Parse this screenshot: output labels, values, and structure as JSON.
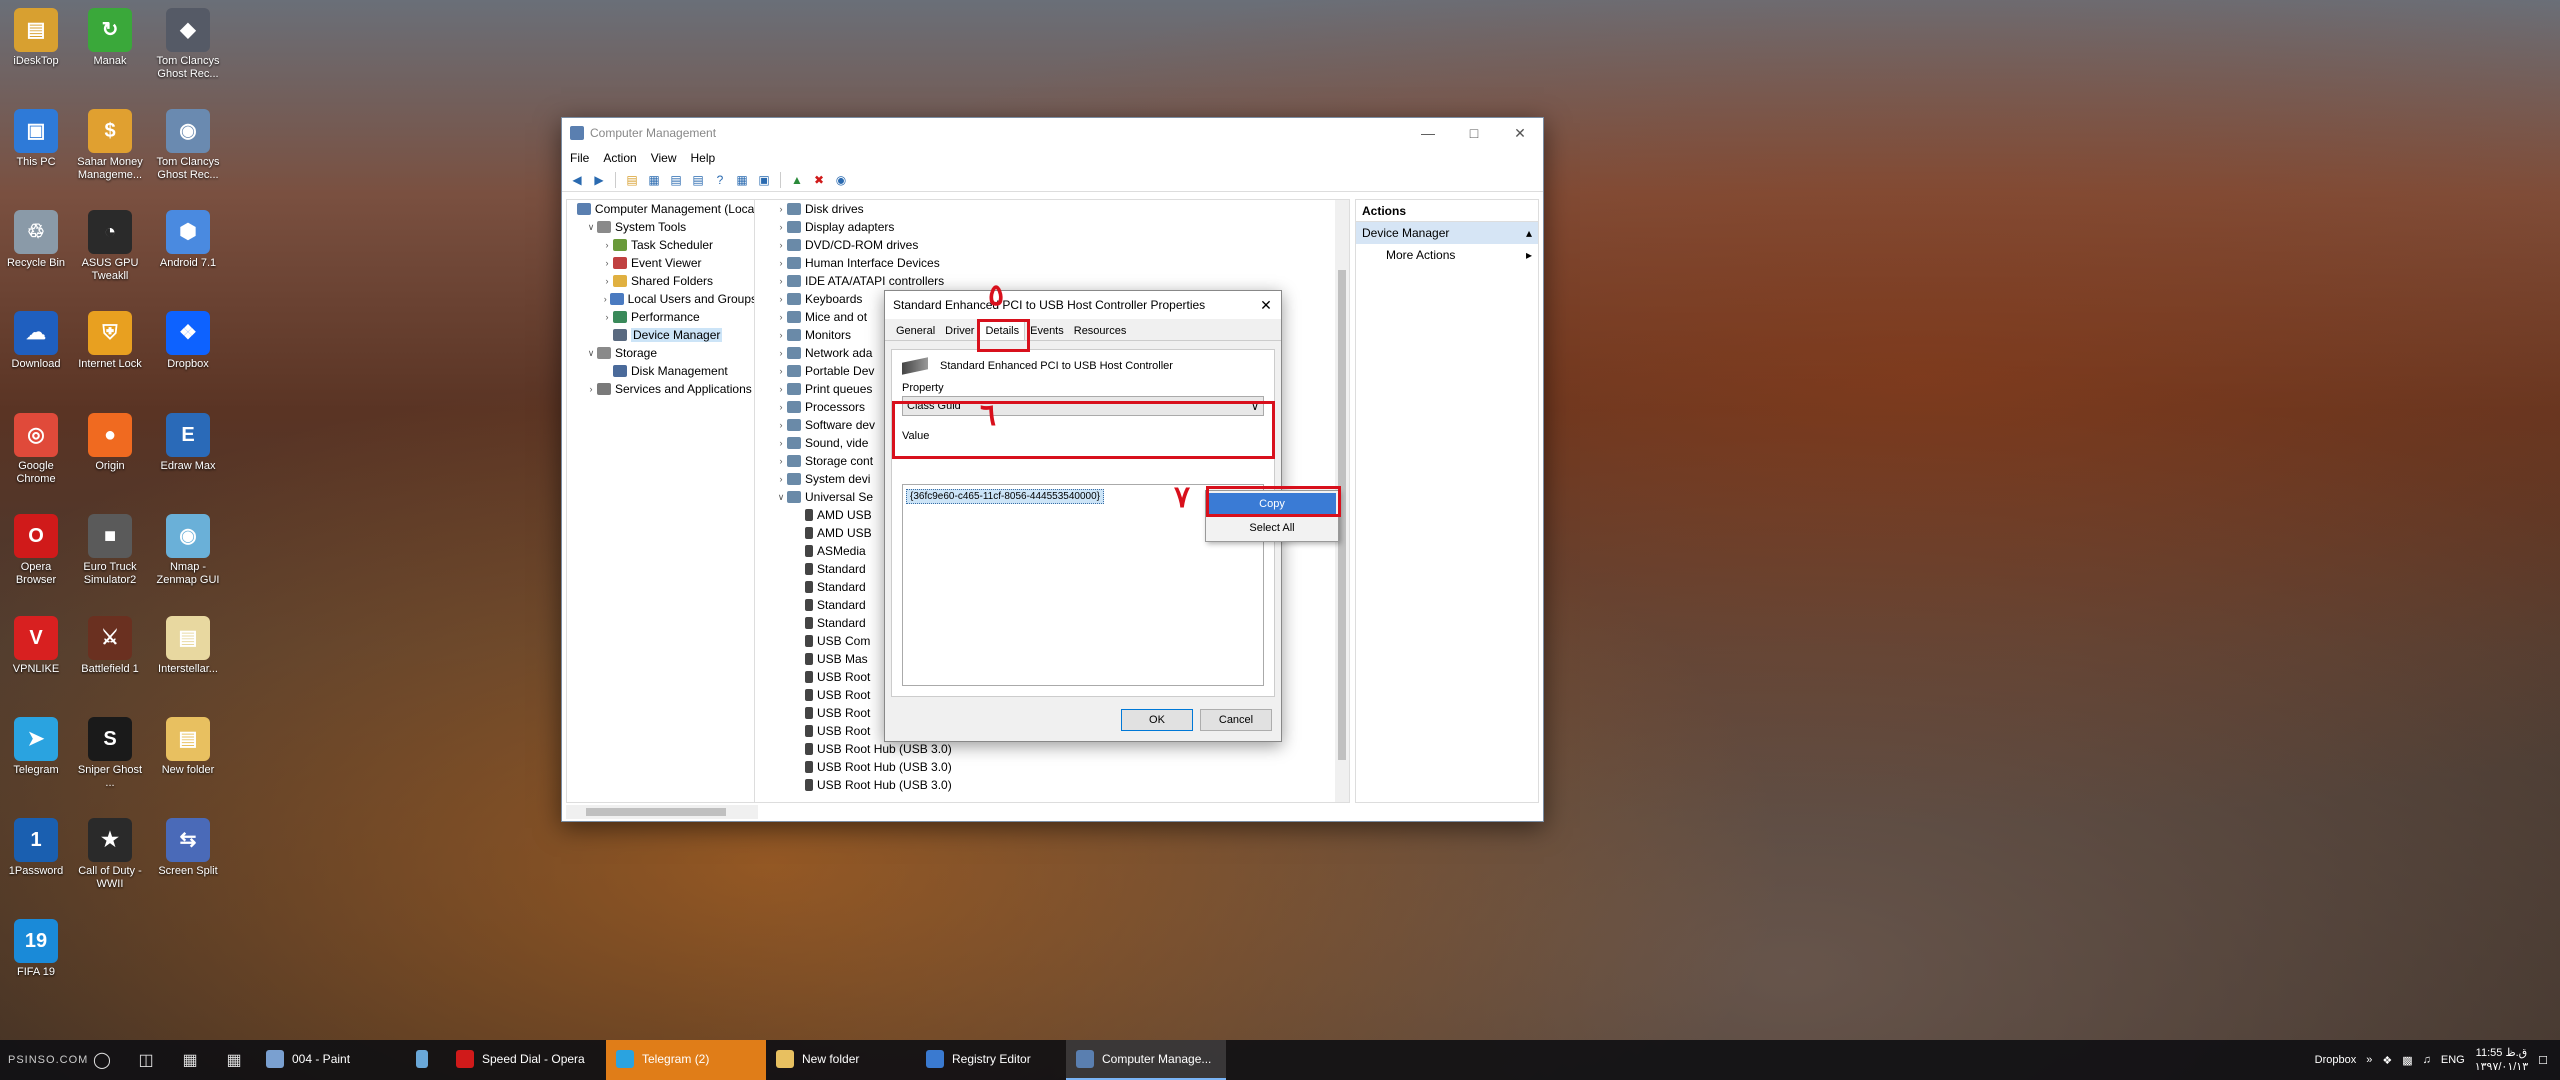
{
  "desktop_icons": [
    {
      "label": "iDeskTop",
      "color": "#d8a030",
      "glyph": "▤"
    },
    {
      "label": "Manak",
      "color": "#3aa83a",
      "glyph": "↻"
    },
    {
      "label": "Tom Clancys Ghost Rec...",
      "color": "#555a66",
      "glyph": "◆"
    },
    {
      "label": "This PC",
      "color": "#2e7ad8",
      "glyph": "▣"
    },
    {
      "label": "Sahar Money Manageme...",
      "color": "#e0a030",
      "glyph": "$"
    },
    {
      "label": "Tom Clancys Ghost Rec...",
      "color": "#6a8ab0",
      "glyph": "◉"
    },
    {
      "label": "Recycle Bin",
      "color": "#8a9aa8",
      "glyph": "♲"
    },
    {
      "label": "ASUS GPU Tweakll",
      "color": "#2a2a2a",
      "glyph": "◔"
    },
    {
      "label": "Android 7.1",
      "color": "#4a8ae0",
      "glyph": "⬢"
    },
    {
      "label": "Download",
      "color": "#1f5fbf",
      "glyph": "☁"
    },
    {
      "label": "Internet Lock",
      "color": "#e8a020",
      "glyph": "⛨"
    },
    {
      "label": "Dropbox",
      "color": "#0d62ff",
      "glyph": "❖"
    },
    {
      "label": "Google Chrome",
      "color": "#e04a3a",
      "glyph": "◎"
    },
    {
      "label": "Origin",
      "color": "#f06a20",
      "glyph": "●"
    },
    {
      "label": "Edraw Max",
      "color": "#2a6ab8",
      "glyph": "E"
    },
    {
      "label": "Opera Browser",
      "color": "#d01a1a",
      "glyph": "O"
    },
    {
      "label": "Euro Truck Simulator2",
      "color": "#5a5a5a",
      "glyph": "■"
    },
    {
      "label": "Nmap - Zenmap GUI",
      "color": "#6ab0d8",
      "glyph": "◉"
    },
    {
      "label": "VPNLIKE",
      "color": "#d82020",
      "glyph": "V"
    },
    {
      "label": "Battlefield 1",
      "color": "#6a3020",
      "glyph": "⚔"
    },
    {
      "label": "Interstellar...",
      "color": "#e8d8a0",
      "glyph": "▤"
    },
    {
      "label": "Telegram",
      "color": "#2aa3e0",
      "glyph": "➤"
    },
    {
      "label": "Sniper Ghost ...",
      "color": "#1a1a1a",
      "glyph": "S"
    },
    {
      "label": "New folder",
      "color": "#e8c060",
      "glyph": "▤"
    },
    {
      "label": "1Password",
      "color": "#1a5fb0",
      "glyph": "1"
    },
    {
      "label": "Call of Duty - WWII",
      "color": "#2a2a2a",
      "glyph": "★"
    },
    {
      "label": "Screen Split",
      "color": "#4a6ab8",
      "glyph": "⇆"
    },
    {
      "label": "FIFA 19",
      "color": "#1a8ad8",
      "glyph": "19"
    }
  ],
  "window": {
    "title": "Computer Management",
    "menu": [
      "File",
      "Action",
      "View",
      "Help"
    ],
    "minimize": "—",
    "maximize": "□",
    "close": "✕"
  },
  "left_tree": [
    {
      "label": "Computer Management (Local",
      "level": 0,
      "exp": "",
      "color": "#5a7fb0"
    },
    {
      "label": "System Tools",
      "level": 1,
      "exp": "∨",
      "color": "#8a8a8a"
    },
    {
      "label": "Task Scheduler",
      "level": 2,
      "exp": "›",
      "color": "#6a9a3a"
    },
    {
      "label": "Event Viewer",
      "level": 2,
      "exp": "›",
      "color": "#c04040"
    },
    {
      "label": "Shared Folders",
      "level": 2,
      "exp": "›",
      "color": "#e0b040"
    },
    {
      "label": "Local Users and Groups",
      "level": 2,
      "exp": "›",
      "color": "#4a7ac0"
    },
    {
      "label": "Performance",
      "level": 2,
      "exp": "›",
      "color": "#3a8a5a"
    },
    {
      "label": "Device Manager",
      "level": 2,
      "exp": "",
      "color": "#5a6a80",
      "selected": true
    },
    {
      "label": "Storage",
      "level": 1,
      "exp": "∨",
      "color": "#8a8a8a"
    },
    {
      "label": "Disk Management",
      "level": 2,
      "exp": "",
      "color": "#4a6a9a"
    },
    {
      "label": "Services and Applications",
      "level": 1,
      "exp": "›",
      "color": "#7a7a7a"
    }
  ],
  "device_tree": [
    {
      "label": "Disk drives",
      "level": 0,
      "exp": "›"
    },
    {
      "label": "Display adapters",
      "level": 0,
      "exp": "›"
    },
    {
      "label": "DVD/CD-ROM drives",
      "level": 0,
      "exp": "›"
    },
    {
      "label": "Human Interface Devices",
      "level": 0,
      "exp": "›"
    },
    {
      "label": "IDE ATA/ATAPI controllers",
      "level": 0,
      "exp": "›"
    },
    {
      "label": "Keyboards",
      "level": 0,
      "exp": "›"
    },
    {
      "label": "Mice and ot",
      "level": 0,
      "exp": "›"
    },
    {
      "label": "Monitors",
      "level": 0,
      "exp": "›"
    },
    {
      "label": "Network ada",
      "level": 0,
      "exp": "›"
    },
    {
      "label": "Portable Dev",
      "level": 0,
      "exp": "›"
    },
    {
      "label": "Print queues",
      "level": 0,
      "exp": "›"
    },
    {
      "label": "Processors",
      "level": 0,
      "exp": "›"
    },
    {
      "label": "Software dev",
      "level": 0,
      "exp": "›"
    },
    {
      "label": "Sound, vide",
      "level": 0,
      "exp": "›"
    },
    {
      "label": "Storage cont",
      "level": 0,
      "exp": "›"
    },
    {
      "label": "System devi",
      "level": 0,
      "exp": "›"
    },
    {
      "label": "Universal Se",
      "level": 0,
      "exp": "∨"
    },
    {
      "label": "AMD USB",
      "level": 1,
      "exp": ""
    },
    {
      "label": "AMD USB",
      "level": 1,
      "exp": ""
    },
    {
      "label": "ASMedia",
      "level": 1,
      "exp": ""
    },
    {
      "label": "Standard",
      "level": 1,
      "exp": ""
    },
    {
      "label": "Standard",
      "level": 1,
      "exp": ""
    },
    {
      "label": "Standard",
      "level": 1,
      "exp": ""
    },
    {
      "label": "Standard",
      "level": 1,
      "exp": ""
    },
    {
      "label": "USB Com",
      "level": 1,
      "exp": ""
    },
    {
      "label": "USB Mas",
      "level": 1,
      "exp": ""
    },
    {
      "label": "USB Root",
      "level": 1,
      "exp": ""
    },
    {
      "label": "USB Root",
      "level": 1,
      "exp": ""
    },
    {
      "label": "USB Root",
      "level": 1,
      "exp": ""
    },
    {
      "label": "USB Root",
      "level": 1,
      "exp": ""
    },
    {
      "label": "USB Root Hub (USB 3.0)",
      "level": 1,
      "exp": ""
    },
    {
      "label": "USB Root Hub (USB 3.0)",
      "level": 1,
      "exp": ""
    },
    {
      "label": "USB Root Hub (USB 3.0)",
      "level": 1,
      "exp": ""
    }
  ],
  "actions": {
    "header": "Actions",
    "section": "Device Manager",
    "section_arrow": "▴",
    "item": "More Actions",
    "item_arrow": "▸"
  },
  "dialog": {
    "title": "Standard Enhanced PCI to USB Host Controller Properties",
    "close": "✕",
    "tabs": [
      "General",
      "Driver",
      "Details",
      "Events",
      "Resources"
    ],
    "active_tab": "Details",
    "device_name": "Standard Enhanced PCI to USB Host Controller",
    "property_label": "Property",
    "property_value": "Class Guid",
    "dropdown_arrow": "∨",
    "value_label": "Value",
    "value_text": "{36fc9e60-c465-11cf-8056-444553540000}",
    "ok": "OK",
    "cancel": "Cancel"
  },
  "context_menu": {
    "copy": "Copy",
    "select_all": "Select All"
  },
  "annotations": {
    "five": "٥",
    "six": "٦",
    "seven": "٧",
    "color": "#d8101c"
  },
  "taskbar": {
    "watermark": "PSINSO.COM",
    "apps": [
      {
        "label": "004 - Paint",
        "color": "#7aa0d0",
        "state": ""
      },
      {
        "label": "",
        "color": "#6aa8d8",
        "state": ""
      },
      {
        "label": "Speed Dial - Opera",
        "color": "#d01a1a",
        "state": ""
      },
      {
        "label": "Telegram (2)",
        "color": "#2aa3e0",
        "state": "flash"
      },
      {
        "label": "New folder",
        "color": "#e8c060",
        "state": ""
      },
      {
        "label": "Registry Editor",
        "color": "#3a7ad0",
        "state": ""
      },
      {
        "label": "Computer Manage...",
        "color": "#5a7fb0",
        "state": "active"
      }
    ],
    "tray_label": "Dropbox",
    "tray_chevron": "»",
    "lang": "ENG",
    "time": "11:55 ق.ظ",
    "date": "۱۳۹۷/۰۱/۱۳",
    "notification": "☐"
  }
}
